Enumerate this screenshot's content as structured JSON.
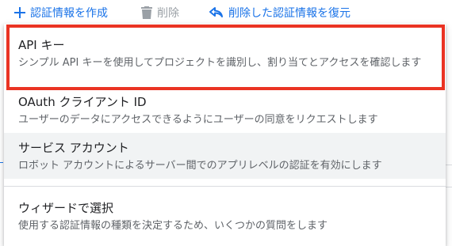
{
  "toolbar": {
    "create_label": "認証情報を作成",
    "delete_label": "削除",
    "restore_label": "削除した認証情報を復元"
  },
  "menu": {
    "items": [
      {
        "title": "API キー",
        "description": "シンプル API キーを使用してプロジェクトを識別し、割り当てとアクセスを確認します"
      },
      {
        "title": "OAuth クライアント ID",
        "description": "ユーザーのデータにアクセスできるようにユーザーの同意をリクエストします"
      },
      {
        "title": "サービス アカウント",
        "description": "ロボット アカウントによるサーバー間でのアプリレベルの認証を有効にします"
      },
      {
        "title": "ウィザードで選択",
        "description": "使用する認証情報の種類を決定するため、いくつかの質問をします"
      }
    ]
  },
  "colors": {
    "accent": "#1a73e8",
    "highlight_border": "#ea3323",
    "hover_background": "#f1f3f4"
  }
}
